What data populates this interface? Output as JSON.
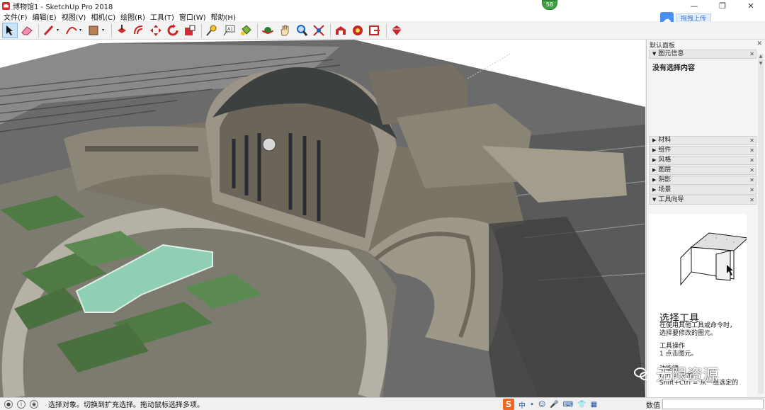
{
  "window": {
    "title": "博物馆1 - SketchUp Pro 2018",
    "notification_count": "58",
    "controls": [
      "—",
      "❐",
      "✕"
    ]
  },
  "menu": [
    "文件(F)",
    "编辑(E)",
    "视图(V)",
    "相机(C)",
    "绘图(R)",
    "工具(T)",
    "窗口(W)",
    "帮助(H)"
  ],
  "upload": {
    "label": "拖拽上传"
  },
  "toolbar": {
    "tools": [
      {
        "name": "select-tool-icon"
      },
      {
        "name": "eraser-tool-icon"
      },
      {
        "name": "line-tool-icon"
      },
      {
        "name": "arc-tool-icon"
      },
      {
        "name": "shape-tool-icon"
      },
      {
        "name": "push-pull-tool-icon"
      },
      {
        "name": "offset-tool-icon"
      },
      {
        "name": "move-tool-icon"
      },
      {
        "name": "rotate-tool-icon"
      },
      {
        "name": "scale-tool-icon"
      },
      {
        "name": "tape-measure-icon"
      },
      {
        "name": "text-tool-icon"
      },
      {
        "name": "paint-bucket-icon"
      },
      {
        "name": "orbit-tool-icon"
      },
      {
        "name": "pan-tool-icon"
      },
      {
        "name": "zoom-tool-icon"
      },
      {
        "name": "zoom-extents-icon"
      },
      {
        "name": "warehouse-icon"
      },
      {
        "name": "extension-warehouse-icon"
      },
      {
        "name": "send-to-layout-icon"
      },
      {
        "name": "extension-manager-icon"
      }
    ]
  },
  "tray": {
    "title": "默认面板",
    "entity_info": {
      "label": "图元信息",
      "content": "没有选择内容"
    },
    "panels": [
      "材料",
      "组件",
      "风格",
      "图层",
      "阴影",
      "场景",
      "工具向导"
    ],
    "instructor": {
      "title": "选择工具",
      "description": "在使用其他工具或命令时，选择要修改的图元。",
      "operation_heading": "工具操作",
      "operation_step": "1 点击图元。",
      "modifier_heading": "功能键",
      "modifier_line1": "Ctrl = 添加",
      "modifier_line2": "Shift+Ctrl = 从一组选定的"
    }
  },
  "status": {
    "message": "选择对象。切换到扩充选择。拖动鼠标选择多项。",
    "measurement_label": "数值",
    "ime": [
      "中",
      "•",
      "☺",
      "🎤",
      "⌨",
      "👕",
      "▦"
    ]
  },
  "watermark": "无限资源"
}
